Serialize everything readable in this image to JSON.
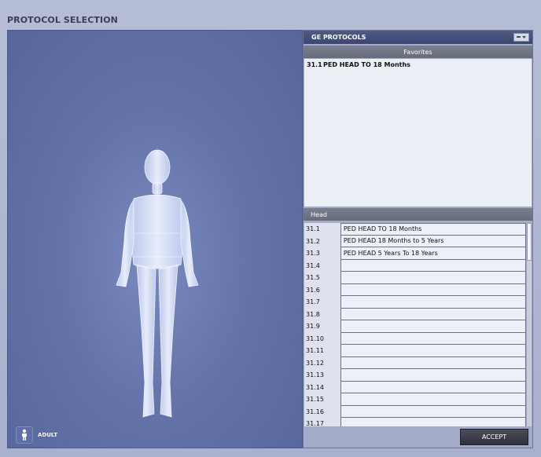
{
  "app": {
    "title": "PROTOCOL SELECTION"
  },
  "stage": {
    "toggle_label": "ADULT",
    "toggle_icon": "person-icon"
  },
  "panel": {
    "title": "GE PROTOCOLS",
    "dropdown_icon": "dropdown-icon",
    "favorites": {
      "label": "Favorites",
      "items": [
        {
          "num": "31.1",
          "name": "PED HEAD TO 18 Months"
        }
      ]
    },
    "group_label": "Head",
    "protocols": [
      {
        "num": "31.1",
        "name": "PED HEAD TO 18 Months"
      },
      {
        "num": "31.2",
        "name": "PED HEAD 18 Months to 5 Years"
      },
      {
        "num": "31.3",
        "name": "PED HEAD 5 Years To 18 Years"
      },
      {
        "num": "31.4",
        "name": ""
      },
      {
        "num": "31.5",
        "name": ""
      },
      {
        "num": "31.6",
        "name": ""
      },
      {
        "num": "31.7",
        "name": ""
      },
      {
        "num": "31.8",
        "name": ""
      },
      {
        "num": "31.9",
        "name": ""
      },
      {
        "num": "31.10",
        "name": ""
      },
      {
        "num": "31.11",
        "name": ""
      },
      {
        "num": "31.12",
        "name": ""
      },
      {
        "num": "31.13",
        "name": ""
      },
      {
        "num": "31.14",
        "name": ""
      },
      {
        "num": "31.15",
        "name": ""
      },
      {
        "num": "31.16",
        "name": ""
      },
      {
        "num": "31.17",
        "name": ""
      }
    ],
    "accept_label": "ACCEPT"
  }
}
